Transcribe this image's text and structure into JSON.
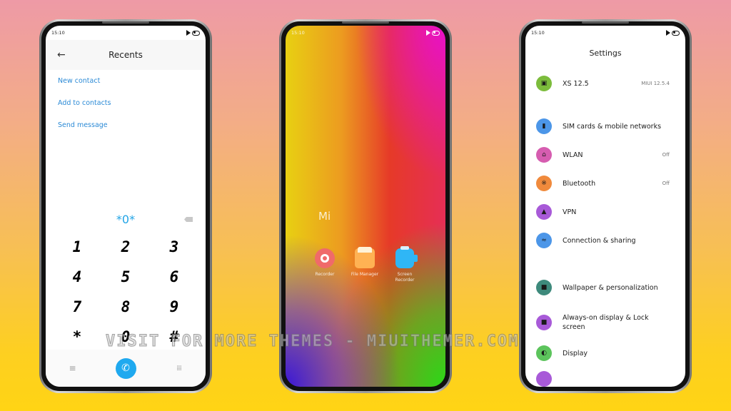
{
  "background": {
    "gradient_top": "#ee9aa6",
    "gradient_bottom": "#ffd414"
  },
  "status_time": "15:10",
  "phone_dialer": {
    "title": "Recents",
    "actions": [
      "New contact",
      "Add to contacts",
      "Send message"
    ],
    "dial_input": "*0*",
    "keys": [
      "1",
      "2",
      "3",
      "4",
      "5",
      "6",
      "7",
      "8",
      "9",
      "*",
      "0",
      "#"
    ],
    "accent_color": "#1fa9ef",
    "link_color": "#2b8ad6"
  },
  "phone_home": {
    "folder_name": "Mi",
    "apps": [
      {
        "label": "Recorder",
        "icon": "recorder-icon"
      },
      {
        "label": "File Manager",
        "icon": "file-manager-icon"
      },
      {
        "label": "Screen Recorder",
        "icon": "screen-recorder-icon"
      }
    ]
  },
  "phone_settings": {
    "title": "Settings",
    "items": [
      {
        "label": "XS 12.5",
        "value": "MIUI 12.5.4",
        "icon": "device-icon",
        "color": "#7cbc3c"
      },
      {
        "label": "SIM cards & mobile networks",
        "value": "",
        "icon": "sim-icon",
        "color": "#4c96e8"
      },
      {
        "label": "WLAN",
        "value": "Off",
        "icon": "wifi-icon",
        "color": "#d65db0"
      },
      {
        "label": "Bluetooth",
        "value": "Off",
        "icon": "bluetooth-icon",
        "color": "#f08a3c"
      },
      {
        "label": "VPN",
        "value": "",
        "icon": "vpn-icon",
        "color": "#a85ad8"
      },
      {
        "label": "Connection & sharing",
        "value": "",
        "icon": "connection-icon",
        "color": "#4c96e8"
      },
      {
        "label": "Wallpaper & personalization",
        "value": "",
        "icon": "wallpaper-icon",
        "color": "#3e8a7c"
      },
      {
        "label": "Always-on display & Lock screen",
        "value": "",
        "icon": "lock-icon",
        "color": "#a85ad8"
      },
      {
        "label": "Display",
        "value": "",
        "icon": "display-icon",
        "color": "#5cc45c"
      }
    ]
  },
  "watermark": "VISIT FOR MORE THEMES - MIUITHEMER.COM"
}
